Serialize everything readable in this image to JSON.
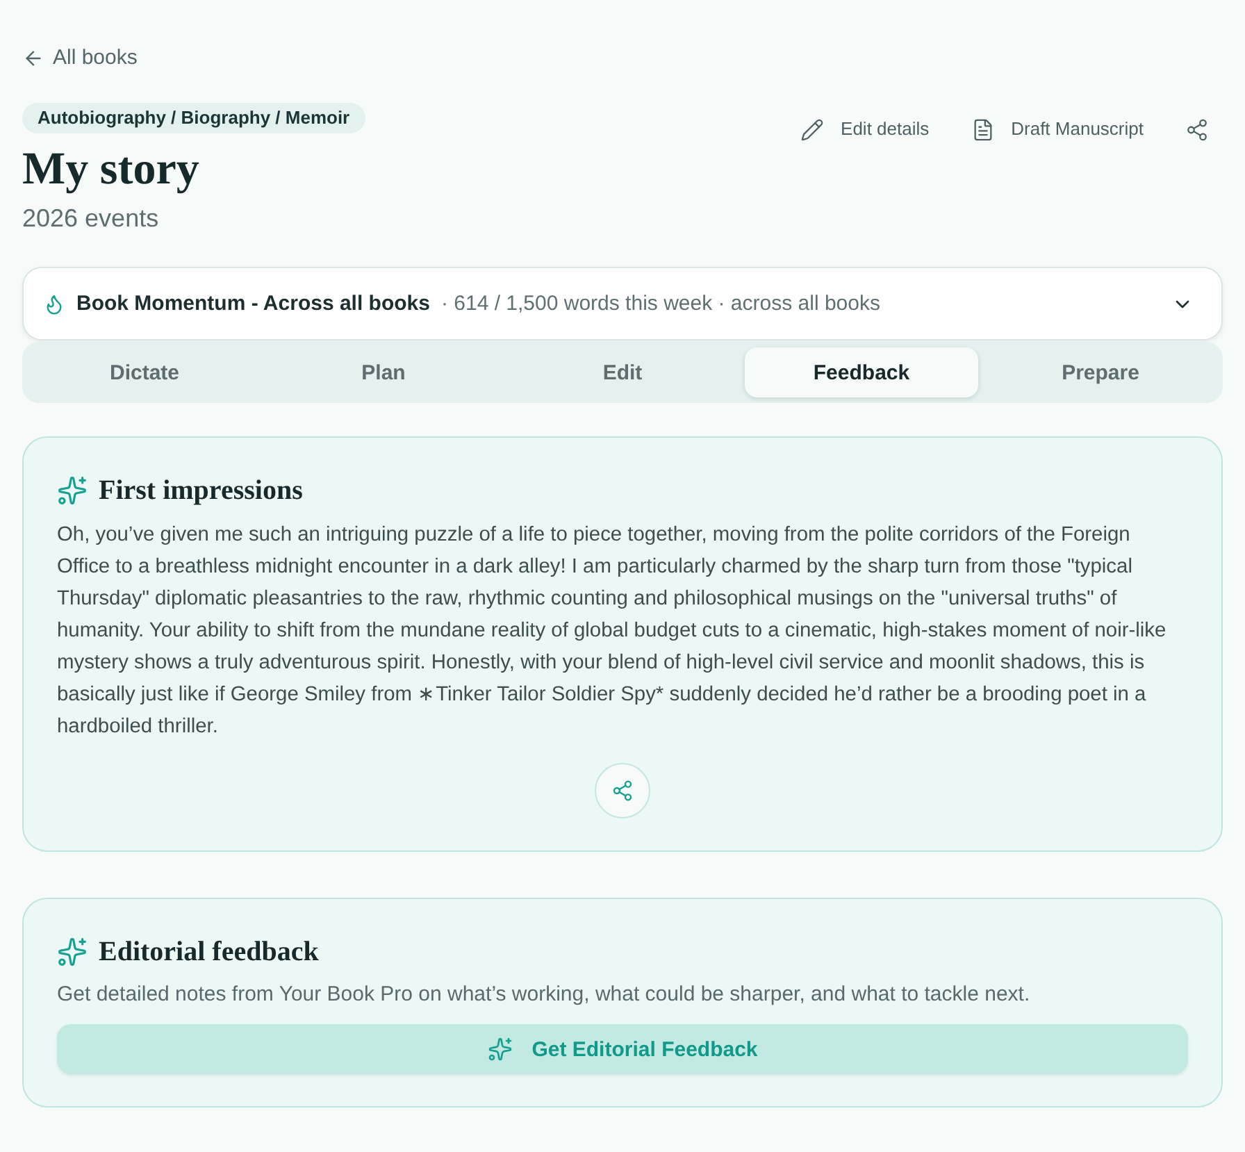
{
  "back_link": {
    "label": "All books"
  },
  "header": {
    "genre": "Autobiography / Biography / Memoir",
    "title": "My story",
    "subtitle": "2026 events",
    "actions": [
      {
        "kind": "edit",
        "label": "Edit details"
      },
      {
        "kind": "document",
        "label": "Draft Manuscript"
      },
      {
        "kind": "share"
      }
    ]
  },
  "momentum": {
    "title": "Book Momentum - Across all books",
    "summary": "· 614 / 1,500 words this week · across all books",
    "expanded": false
  },
  "tabs": [
    {
      "label": "Dictate",
      "selected": false
    },
    {
      "label": "Plan",
      "selected": false
    },
    {
      "label": "Edit",
      "selected": false
    },
    {
      "label": "Feedback",
      "selected": true
    },
    {
      "label": "Prepare",
      "selected": false
    }
  ],
  "cards": [
    {
      "kind": "impressions",
      "title": "First impressions",
      "body": "Oh, you’ve given me such an intriguing puzzle of a life to piece together, moving from the polite corridors of the Foreign Office to a breathless midnight encounter in a dark alley! I am particularly charmed by the sharp turn from those \"typical Thursday\" diplomatic pleasantries to the raw, rhythmic counting and philosophical musings on the \"universal truths\" of humanity. Your ability to shift from the mundane reality of global budget cuts to a cinematic, high-stakes moment of noir-like mystery shows a truly adventurous spirit. Honestly, with your blend of high-level civil service and moonlit shadows, this is basically just like if George Smiley from ∗Tinker Tailor Soldier Spy* suddenly decided he’d rather be a brooding poet in a hardboiled thriller."
    },
    {
      "kind": "editorial",
      "title": "Editorial feedback",
      "body": "Get detailed notes from Your Book Pro on what’s working, what could be sharper, and what to tackle next.",
      "button": "Get Editorial Feedback"
    }
  ]
}
